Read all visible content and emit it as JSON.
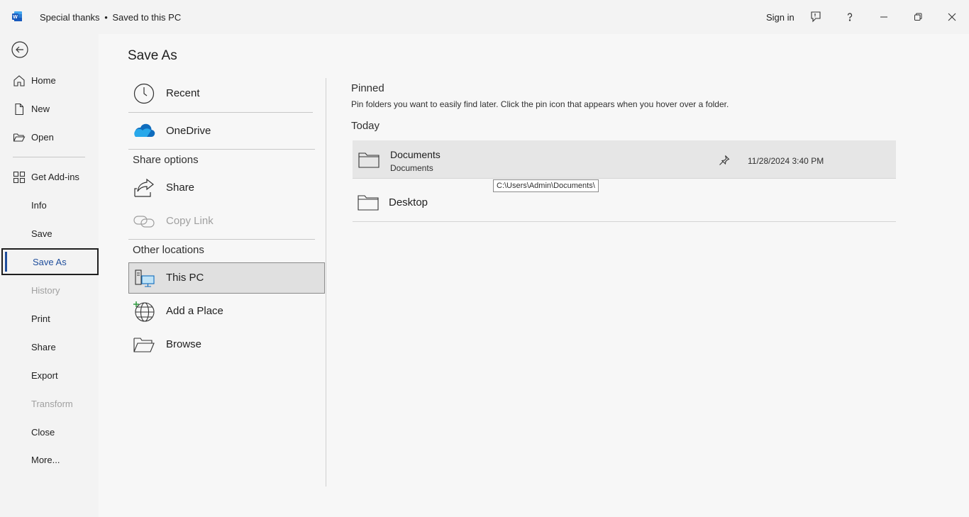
{
  "titlebar": {
    "title": "Special thanks",
    "separator": "•",
    "status": "Saved to this PC",
    "signin": "Sign in"
  },
  "icons": {
    "app": "word-logo-icon",
    "feedback": "feedback-icon",
    "help": "help-icon",
    "minimize": "minimize-icon",
    "restore": "restore-icon",
    "close": "close-icon"
  },
  "nav": {
    "home": "Home",
    "new": "New",
    "open": "Open",
    "addins": "Get Add-ins",
    "info": "Info",
    "save": "Save",
    "saveas": "Save As",
    "history": "History",
    "print": "Print",
    "share": "Share",
    "export": "Export",
    "transform": "Transform",
    "close": "Close",
    "more": "More..."
  },
  "page": {
    "title": "Save As"
  },
  "locations": {
    "recent": "Recent",
    "onedrive": "OneDrive",
    "share_options": "Share options",
    "share": "Share",
    "copy_link": "Copy Link",
    "other_locations": "Other locations",
    "this_pc": "This PC",
    "add_place": "Add a Place",
    "browse": "Browse"
  },
  "content": {
    "pinned_heading": "Pinned",
    "pinned_desc": "Pin folders you want to easily find later. Click the pin icon that appears when you hover over a folder.",
    "today_heading": "Today",
    "folders": [
      {
        "name": "Documents",
        "path": "Documents",
        "date": "11/28/2024 3:40 PM"
      },
      {
        "name": "Desktop"
      }
    ],
    "tooltip": "C:\\Users\\Admin\\Documents\\"
  },
  "colors": {
    "accent": "#1f4e9c",
    "word_blue": "#185abd",
    "onedrive_blue": "#0f6cbd"
  }
}
